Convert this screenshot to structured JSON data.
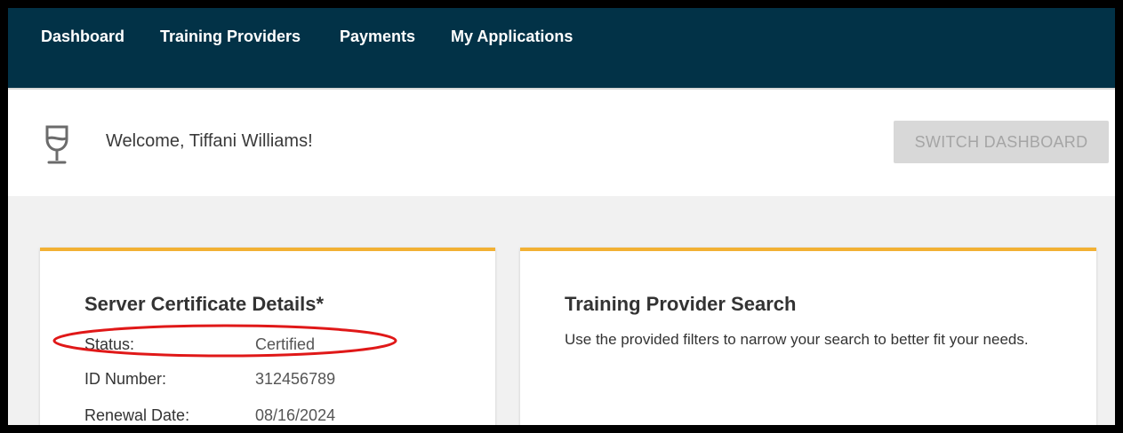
{
  "nav": {
    "items": [
      {
        "label": "Dashboard",
        "icon": ""
      },
      {
        "label": "Training Providers"
      },
      {
        "label": "Payments"
      },
      {
        "label": "My Applications"
      }
    ]
  },
  "welcome": {
    "icon": "wine-glass-icon",
    "text": "Welcome, Tiffani Williams!",
    "switch_label": "SWITCH DASHBOARD"
  },
  "certificate": {
    "title": "Server Certificate Details*",
    "rows": [
      {
        "label": "Status:",
        "value": "Certified"
      },
      {
        "label": "ID Number:",
        "value": "312456789"
      },
      {
        "label": "Renewal Date:",
        "value": "08/16/2024"
      }
    ]
  },
  "search": {
    "title": "Training Provider Search",
    "description": "Use the provided filters to narrow your search to better fit your needs."
  },
  "colors": {
    "nav_bg": "#023247",
    "card_accent": "#f2b134",
    "highlight": "#e01818"
  }
}
